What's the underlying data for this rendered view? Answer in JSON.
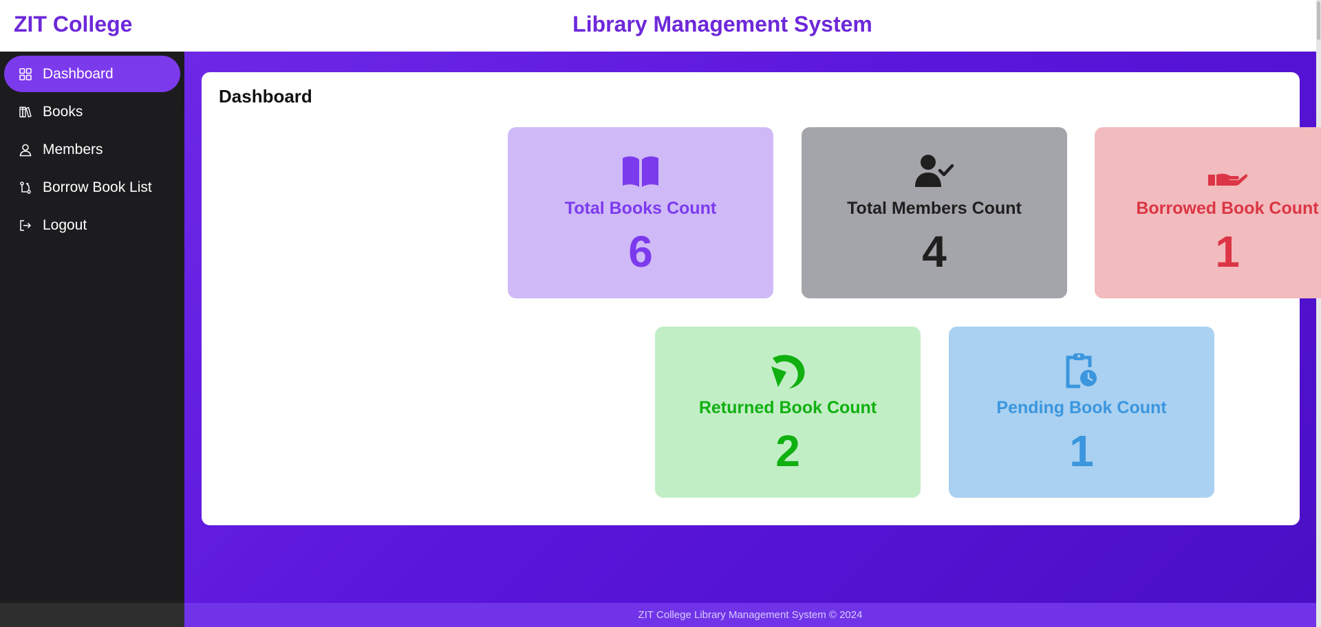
{
  "header": {
    "brand": "ZIT College",
    "title": "Library Management System"
  },
  "sidebar": {
    "items": [
      {
        "label": "Dashboard",
        "icon": "grid-icon",
        "active": true
      },
      {
        "label": "Books",
        "icon": "books-icon"
      },
      {
        "label": "Members",
        "icon": "user-icon"
      },
      {
        "label": "Borrow Book List",
        "icon": "borrow-icon"
      },
      {
        "label": "Logout",
        "icon": "logout-icon"
      }
    ]
  },
  "main": {
    "title": "Dashboard",
    "cards": [
      {
        "label": "Total Books Count",
        "value": "6",
        "icon": "open-book-icon",
        "color": "#7c3aed",
        "bg": "#cfbaf7"
      },
      {
        "label": "Total Members Count",
        "value": "4",
        "icon": "user-check-icon",
        "color": "#1f1f1f",
        "bg": "#a4a5aa"
      },
      {
        "label": "Borrowed Book Count",
        "value": "1",
        "icon": "hand-icon",
        "color": "#dc3545",
        "bg": "#f2bbbe"
      },
      {
        "label": "Returned Book Count",
        "value": "2",
        "icon": "return-arrow-icon",
        "color": "#10b010",
        "bg": "#c2eec6"
      },
      {
        "label": "Pending Book Count",
        "value": "1",
        "icon": "clipboard-clock-icon",
        "color": "#3b96de",
        "bg": "#aad1f1"
      }
    ]
  },
  "footer": {
    "text": "ZIT College Library Management System © 2024"
  }
}
